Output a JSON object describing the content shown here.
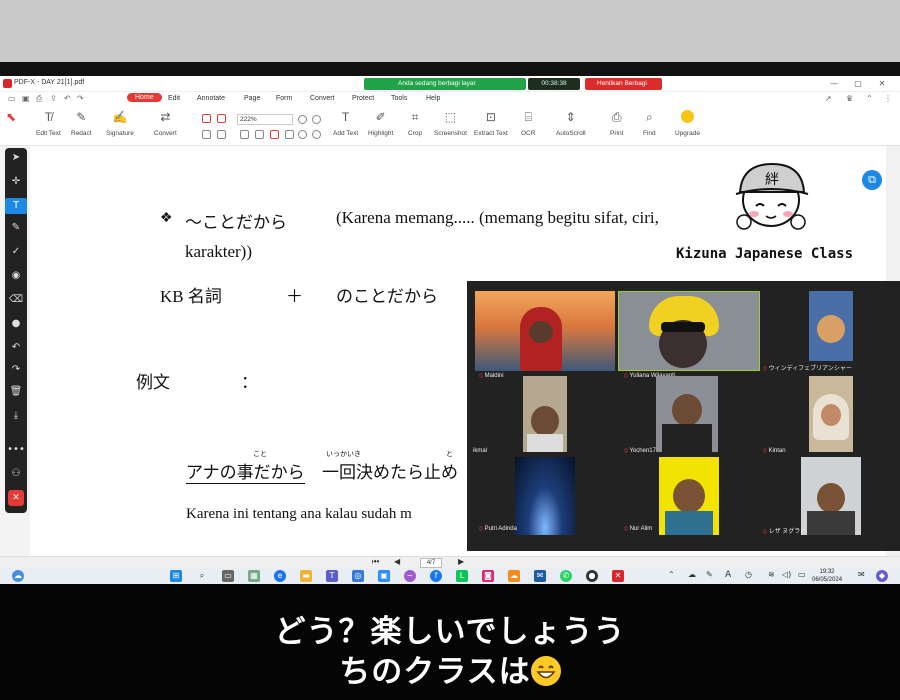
{
  "app": {
    "title": "PDF-X - DAY 21[1].pdf",
    "sharing_text": "Anda sedang berbagi layar",
    "timer": "00:38:38",
    "stop_share": "Hentikan Berbagi"
  },
  "menu": [
    "Home",
    "Edit",
    "Annotate",
    "Page",
    "Form",
    "Convert",
    "Protect",
    "Tools",
    "Help"
  ],
  "ribbon": {
    "zoom": "222%",
    "tools": [
      "Edit Text",
      "Redact",
      "Signature",
      "Convert",
      "Add Text",
      "Highlight",
      "Crop",
      "Screenshot",
      "Extract Text",
      "OCR",
      "AutoScroll",
      "Print",
      "Find",
      "Upgrade"
    ]
  },
  "document": {
    "line1_marker": "❖",
    "line1_jp": "〜ことだから",
    "line1_id": "(Karena memang..... (memang begitu sifat, ciri,",
    "line2": "karakter))",
    "line3_kb": "KB 名詞",
    "line3_plus": "＋",
    "line3_jp": "のことだから",
    "line4": "例文",
    "line4_colon": "：",
    "line5_underlined": "アナの事だから",
    "line5_rest": "一回決めたら止め",
    "furigana1": "こと",
    "furigana2": "いっかいき",
    "furigana3": "と",
    "line6": "Karena ini tentang ana kalau sudah m"
  },
  "watermark": {
    "cap_kanji": "絆",
    "name": "Kizuna Japanese Class"
  },
  "participants": [
    {
      "name": "Maldini"
    },
    {
      "name": "Yuliana Wijayanti"
    },
    {
      "name": "ウィンディフェブリアンシャー"
    },
    {
      "name": "ikmal"
    },
    {
      "name": "Yochen17"
    },
    {
      "name": "Kintan"
    },
    {
      "name": "Putri Adinda"
    },
    {
      "name": "Nur Alim"
    },
    {
      "name": "レザ ヌグラハ"
    }
  ],
  "navbar": {
    "page": "4/7"
  },
  "taskbar": {
    "time": "19:32",
    "date": "06/05/2024",
    "lang": "A"
  },
  "caption": {
    "line1": "どう？楽しいでしょうう",
    "line2": "ちのクラスは"
  },
  "colors": {
    "accent_red": "#e53935",
    "share_green": "#22a34a",
    "toolbar_blue": "#1e88e5"
  }
}
